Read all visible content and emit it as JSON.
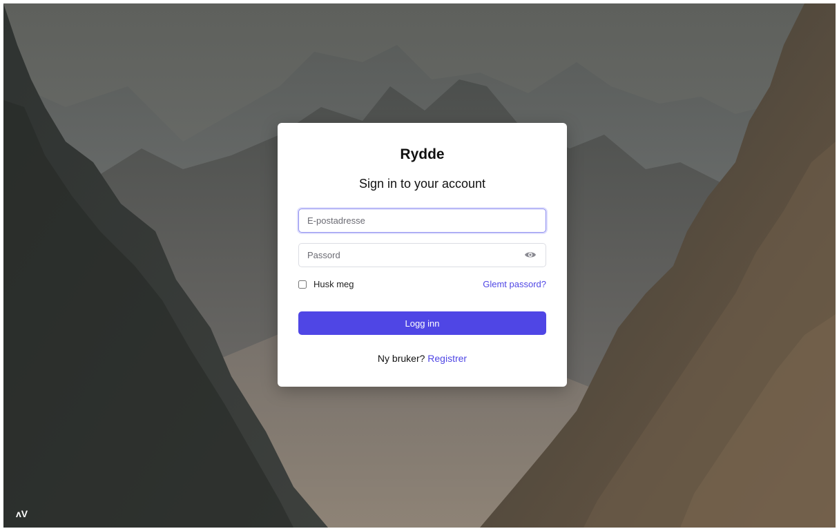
{
  "app": {
    "brand": "Rydde",
    "corner_logo": "ʌV"
  },
  "login": {
    "subtitle": "Sign in to your account",
    "email_placeholder": "E-postadresse",
    "email_value": "",
    "password_placeholder": "Passord",
    "password_value": "",
    "remember_label": "Husk meg",
    "remember_checked": false,
    "forgot_label": "Glemt passord?",
    "submit_label": "Logg inn",
    "signup_prompt": "Ny bruker?",
    "signup_link": "Registrer"
  },
  "icons": {
    "password_toggle": "eye-icon"
  },
  "colors": {
    "accent": "#4f46e5",
    "card_bg": "#ffffff",
    "focus_ring": "#8e8ef0"
  }
}
